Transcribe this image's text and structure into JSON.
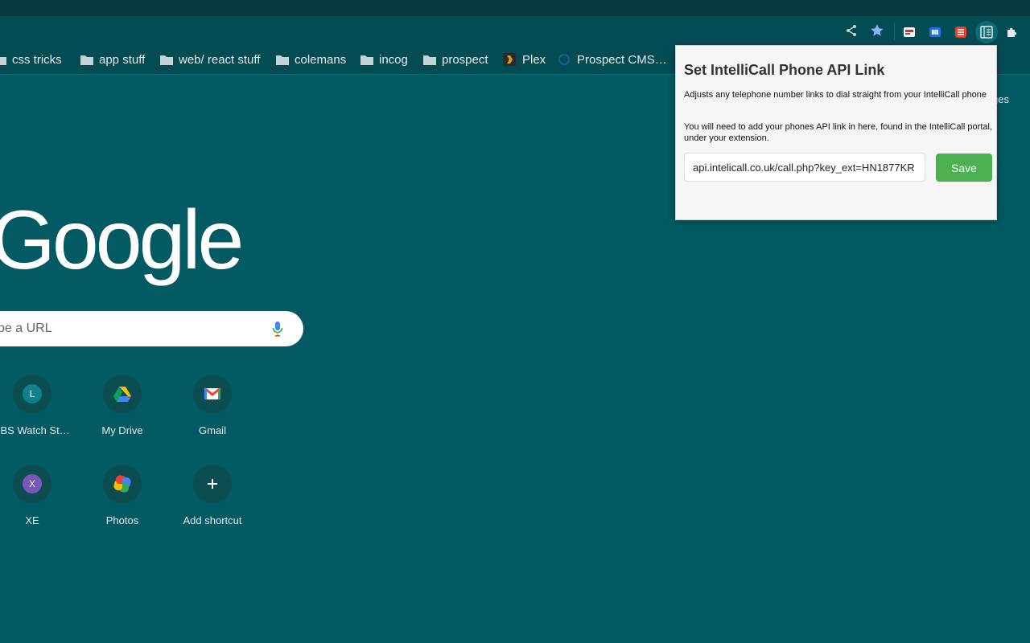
{
  "toolbar": {
    "icons": [
      "share-icon",
      "bookmark-star-icon",
      "extension-icon",
      "extension-icon",
      "extension-icon",
      "intellicall-extension-icon",
      "extensions-puzzle-icon"
    ]
  },
  "bookmarks": [
    {
      "label": "css tricks",
      "icon": "folder-icon"
    },
    {
      "label": "app stuff",
      "icon": "folder-icon"
    },
    {
      "label": "web/ react stuff",
      "icon": "folder-icon"
    },
    {
      "label": "colemans",
      "icon": "folder-icon"
    },
    {
      "label": "incog",
      "icon": "folder-icon"
    },
    {
      "label": "prospect",
      "icon": "folder-icon"
    },
    {
      "label": "Plex",
      "icon": "plex-icon"
    },
    {
      "label": "Prospect CMS…",
      "icon": "site-icon"
    }
  ],
  "ntp": {
    "logo": "Google",
    "search_placeholder": "ype a URL",
    "manage_fragment": "ges",
    "shortcuts": [
      {
        "label": "LBS Watch St…",
        "letter": "L"
      },
      {
        "label": "My Drive",
        "icon": "google-drive-icon"
      },
      {
        "label": "Gmail",
        "icon": "gmail-icon"
      },
      {
        "label": "XE",
        "letter": "X"
      },
      {
        "label": "Photos",
        "icon": "google-photos-icon"
      },
      {
        "label": "Add shortcut",
        "icon": "plus-icon"
      }
    ]
  },
  "popup": {
    "title": "Set IntelliCall Phone API Link",
    "desc1": "Adjusts any telephone number links to dial straight from your IntelliCall phone",
    "desc2": "You will need to add your phones API link in here, found in the IntelliCall portal, under your extension.",
    "api_link_value": "api.intelicall.co.uk/call.php?key_ext=HN1877KR",
    "save_label": "Save"
  },
  "colors": {
    "background": "#035a62",
    "toolbar": "#044c54",
    "save_button": "#4caf50"
  }
}
